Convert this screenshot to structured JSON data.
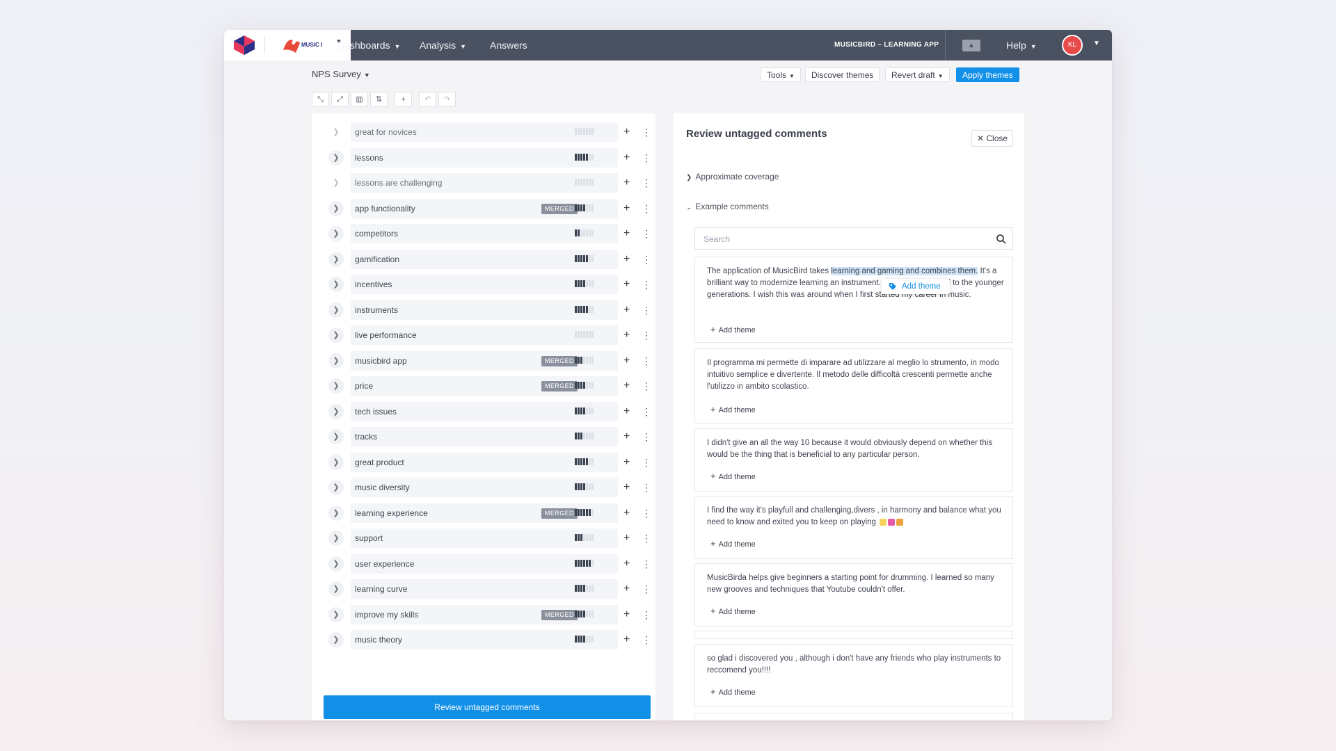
{
  "nav": {
    "items": [
      {
        "label": "Dashboards",
        "has_chevron": true
      },
      {
        "label": "Analysis",
        "has_chevron": true
      },
      {
        "label": "Answers",
        "has_chevron": false
      }
    ],
    "org_name": "MUSICBIRD – LEARNING APP",
    "help_label": "Help",
    "avatar_initials": "KL",
    "product_logo_text": "MUSIC BIRD",
    "accent_color": "#1290e8",
    "nav_bg_color": "#4a5160"
  },
  "toolbar": {
    "survey_label": "NPS Survey",
    "tools_label": "Tools",
    "discover_label": "Discover themes",
    "revert_label": "Revert draft",
    "apply_label": "Apply themes",
    "icons": [
      "collapse-icon",
      "expand-icon",
      "chart-icon",
      "sort-icon",
      "add-icon",
      "undo-icon",
      "redo-icon"
    ]
  },
  "themes": [
    {
      "label": "great for novices",
      "merged": false,
      "level": 0,
      "muted": true
    },
    {
      "label": "lessons",
      "merged": false,
      "level": 5,
      "muted": false
    },
    {
      "label": "lessons are challenging",
      "merged": false,
      "level": 0,
      "muted": true
    },
    {
      "label": "app functionality",
      "merged": true,
      "level": 4,
      "muted": false
    },
    {
      "label": "competitors",
      "merged": false,
      "level": 2,
      "muted": false
    },
    {
      "label": "gamification",
      "merged": false,
      "level": 5,
      "muted": false
    },
    {
      "label": "incentives",
      "merged": false,
      "level": 4,
      "muted": false
    },
    {
      "label": "instruments",
      "merged": false,
      "level": 5,
      "muted": false
    },
    {
      "label": "live performance",
      "merged": false,
      "level": 0,
      "muted": false
    },
    {
      "label": "musicbird app",
      "merged": true,
      "level": 3,
      "muted": false
    },
    {
      "label": "price",
      "merged": true,
      "level": 4,
      "muted": false
    },
    {
      "label": "tech issues",
      "merged": false,
      "level": 4,
      "muted": false
    },
    {
      "label": "tracks",
      "merged": false,
      "level": 3,
      "muted": false
    },
    {
      "label": "great product",
      "merged": false,
      "level": 5,
      "muted": false
    },
    {
      "label": "music diversity",
      "merged": false,
      "level": 4,
      "muted": false
    },
    {
      "label": "learning experience",
      "merged": true,
      "level": 6,
      "muted": false
    },
    {
      "label": "support",
      "merged": false,
      "level": 3,
      "muted": false
    },
    {
      "label": "user experience",
      "merged": false,
      "level": 6,
      "muted": false
    },
    {
      "label": "learning curve",
      "merged": false,
      "level": 4,
      "muted": false
    },
    {
      "label": "improve my skills",
      "merged": true,
      "level": 4,
      "muted": false
    },
    {
      "label": "music theory",
      "merged": false,
      "level": 4,
      "muted": false
    }
  ],
  "merged_label": "MERGED",
  "review_button_label": "Review untagged comments",
  "review_panel": {
    "title": "Review untagged comments",
    "close_label": "Close",
    "coverage_label": "Approximate coverage",
    "examples_label": "Example comments",
    "search_placeholder": "Search",
    "add_theme_label": "Add theme",
    "popup_label": "Add theme",
    "comments": [
      {
        "pre": "The application of MusicBird takes ",
        "highlight": "learning and gaming and combines them.",
        "post": " It's a brilliant way to modernize learning an instrument. It's a strong appeal to the younger generations. I wish this was around when I first started my career in music."
      },
      {
        "text": "Il programma mi permette di imparare ad utilizzare al meglio lo strumento, in modo intuitivo semplice e divertente. Il metodo delle difficoltà crescenti permette anche l'utilizzo in ambito scolastico."
      },
      {
        "text": "I didn't give an all the way 10 because it would obviously depend on whether this would be the thing that is beneficial to any particular person."
      },
      {
        "text": "I find the way it's playfull and challenging,divers , in harmony and balance what you need to know and exited you to keep on playing"
      },
      {
        "text": "MusicBirda helps give beginners a starting point for drumming. I learned so many new grooves and techniques that Youtube couldn't offer."
      },
      {
        "text": "so glad i discovered you , although i don't have any friends who play instruments to reccomend you!!!!"
      }
    ]
  }
}
